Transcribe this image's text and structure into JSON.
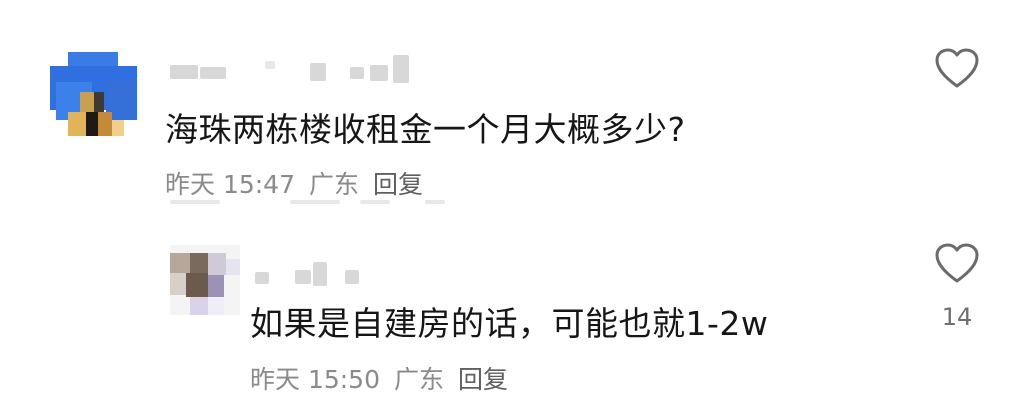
{
  "comments": [
    {
      "text": "海珠两栋楼收租金一个月大概多少?",
      "meta": {
        "time": "昨天 15:47",
        "location": "广东",
        "reply": "回复"
      },
      "like_count": ""
    }
  ],
  "reply": {
    "text": "如果是自建房的话，可能也就1-2w",
    "meta": {
      "time": "昨天 15:50",
      "location": "广东",
      "reply": "回复"
    },
    "like_count": "14"
  },
  "colors": {
    "text": "#161616",
    "meta": "#8a8a8a",
    "reply_link": "#5f5f5f",
    "heart_stroke": "#6b6b6b",
    "avatar_main": "#2f6fe0"
  },
  "icons": {
    "like": "heart-outline-icon"
  }
}
